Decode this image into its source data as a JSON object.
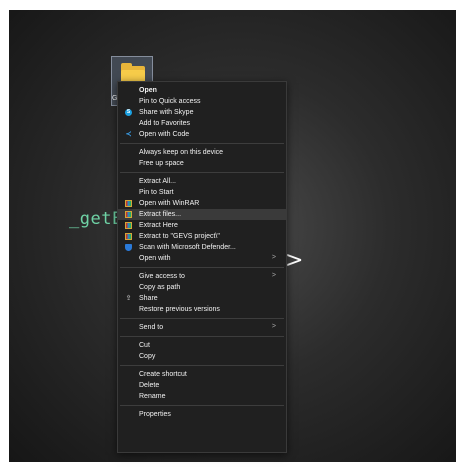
{
  "background": {
    "code_text": "_getE",
    "arrow_glyph": ">"
  },
  "desktop_icon": {
    "label": "G"
  },
  "menu": {
    "groups": [
      [
        {
          "label": "Open",
          "bold": true
        },
        {
          "label": "Pin to Quick access"
        },
        {
          "label": "Share with Skype",
          "icon": "skype-icon"
        },
        {
          "label": "Add to Favorites"
        },
        {
          "label": "Open with Code",
          "icon": "vscode-icon"
        }
      ],
      [
        {
          "label": "Always keep on this device"
        },
        {
          "label": "Free up space"
        }
      ],
      [
        {
          "label": "Extract All..."
        },
        {
          "label": "Pin to Start"
        },
        {
          "label": "Open with WinRAR",
          "icon": "winrar-icon"
        },
        {
          "label": "Extract files...",
          "icon": "winrar-icon",
          "hover": true
        },
        {
          "label": "Extract Here",
          "icon": "winrar-icon"
        },
        {
          "label": "Extract to \"GEVS project\\\"",
          "icon": "winrar-icon"
        },
        {
          "label": "Scan with Microsoft Defender...",
          "icon": "defender-icon"
        },
        {
          "label": "Open with",
          "submenu": true
        }
      ],
      [
        {
          "label": "Give access to",
          "submenu": true
        },
        {
          "label": "Copy as path"
        },
        {
          "label": "Share",
          "icon": "share-icon"
        },
        {
          "label": "Restore previous versions"
        }
      ],
      [
        {
          "label": "Send to",
          "submenu": true
        }
      ],
      [
        {
          "label": "Cut"
        },
        {
          "label": "Copy"
        }
      ],
      [
        {
          "label": "Create shortcut"
        },
        {
          "label": "Delete"
        },
        {
          "label": "Rename"
        }
      ],
      [
        {
          "label": "Properties"
        }
      ]
    ]
  },
  "icons": {
    "skype-icon": "S",
    "vscode-icon": "≺",
    "share-icon": "⇪"
  },
  "submenu_glyph": ">"
}
